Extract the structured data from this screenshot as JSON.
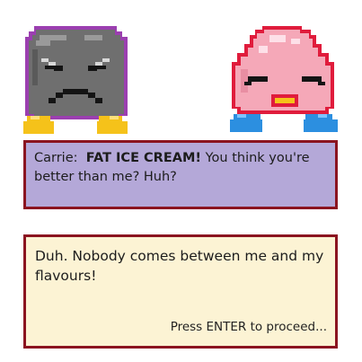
{
  "scene": {
    "characters": [
      {
        "name": "Carrie",
        "sprite": "angry-rock-icon",
        "colors": {
          "body": "#707070",
          "outline": "#9b3fb0",
          "feet": "#f5c21a"
        }
      },
      {
        "sprite": "fat-ice-cream-icon",
        "colors": {
          "body": "#f5a8b8",
          "outline": "#e01c3c",
          "feet": "#2c8fe0"
        }
      }
    ]
  },
  "dialogue": {
    "speaker": "Carrie",
    "speaker_sep": ":",
    "shout": "FAT ICE CREAM!",
    "line_rest": "You think you're better than me? Huh?",
    "reply": "Duh. Nobody comes between me and my flavours!",
    "prompt": "Press ENTER to proceed..."
  },
  "colors": {
    "dialog_border": "#8b1420",
    "speaker_bg": "#b4a8d8",
    "reply_bg": "#fcf3d4"
  }
}
